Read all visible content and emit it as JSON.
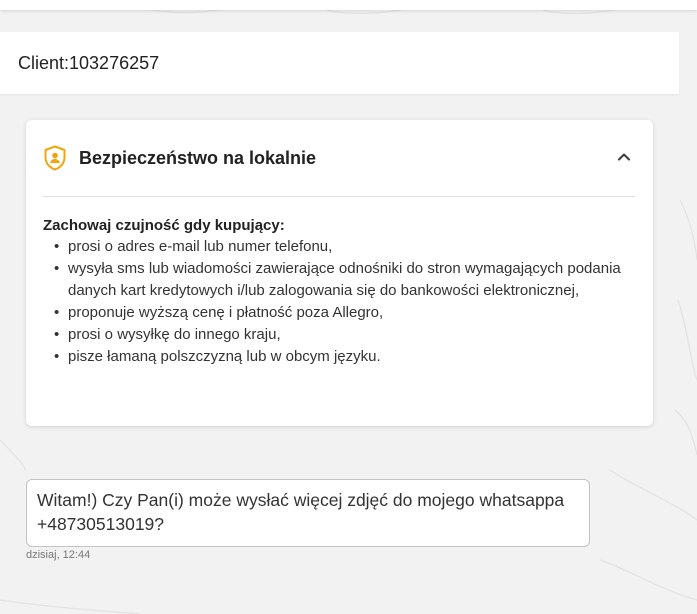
{
  "client_bar": {
    "label": "Client:103276257"
  },
  "safety_card": {
    "icon": "shield-user-icon",
    "accent_color": "#f2a40c",
    "title": "Bezpieczeństwo na lokalnie",
    "collapse_icon": "chevron-up-icon",
    "warning_heading": "Zachowaj czujność gdy kupujący:",
    "warnings": [
      "prosi o adres e-mail lub numer telefonu,",
      "wysyła sms lub wiadomości zawierające odnośniki do stron wymagających podania danych kart kredytowych i/lub zalogowania się do bankowości elektronicznej,",
      "proponuje wyższą cenę i płatność poza Allegro,",
      "prosi o wysyłkę do innego kraju,",
      "pisze łamaną polszczyzną lub w obcym języku."
    ]
  },
  "message": {
    "text": "Witam!) Czy Pan(i) może wysłać więcej zdjęć do mojego whatsappa +48730513019?",
    "timestamp": "dzisiaj, 12:44"
  }
}
